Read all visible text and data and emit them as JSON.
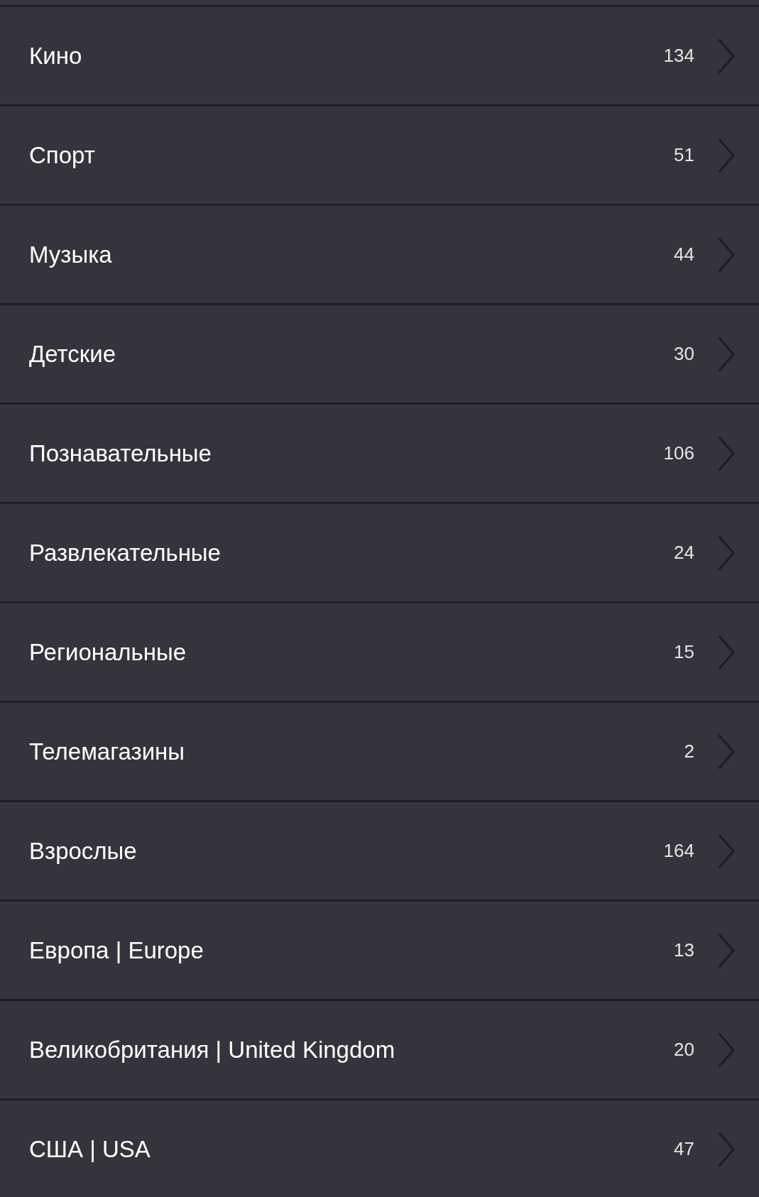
{
  "categories": [
    {
      "label": "Кино",
      "count": "134"
    },
    {
      "label": "Спорт",
      "count": "51"
    },
    {
      "label": "Музыка",
      "count": "44"
    },
    {
      "label": "Детские",
      "count": "30"
    },
    {
      "label": "Познавательные",
      "count": "106"
    },
    {
      "label": "Развлекательные",
      "count": "24"
    },
    {
      "label": "Региональные",
      "count": "15"
    },
    {
      "label": "Телемагазины",
      "count": "2"
    },
    {
      "label": "Взрослые",
      "count": "164"
    },
    {
      "label": "Европа | Europe",
      "count": "13"
    },
    {
      "label": "Великобритания | United Kingdom",
      "count": "20"
    },
    {
      "label": "США | USA",
      "count": "47"
    }
  ]
}
